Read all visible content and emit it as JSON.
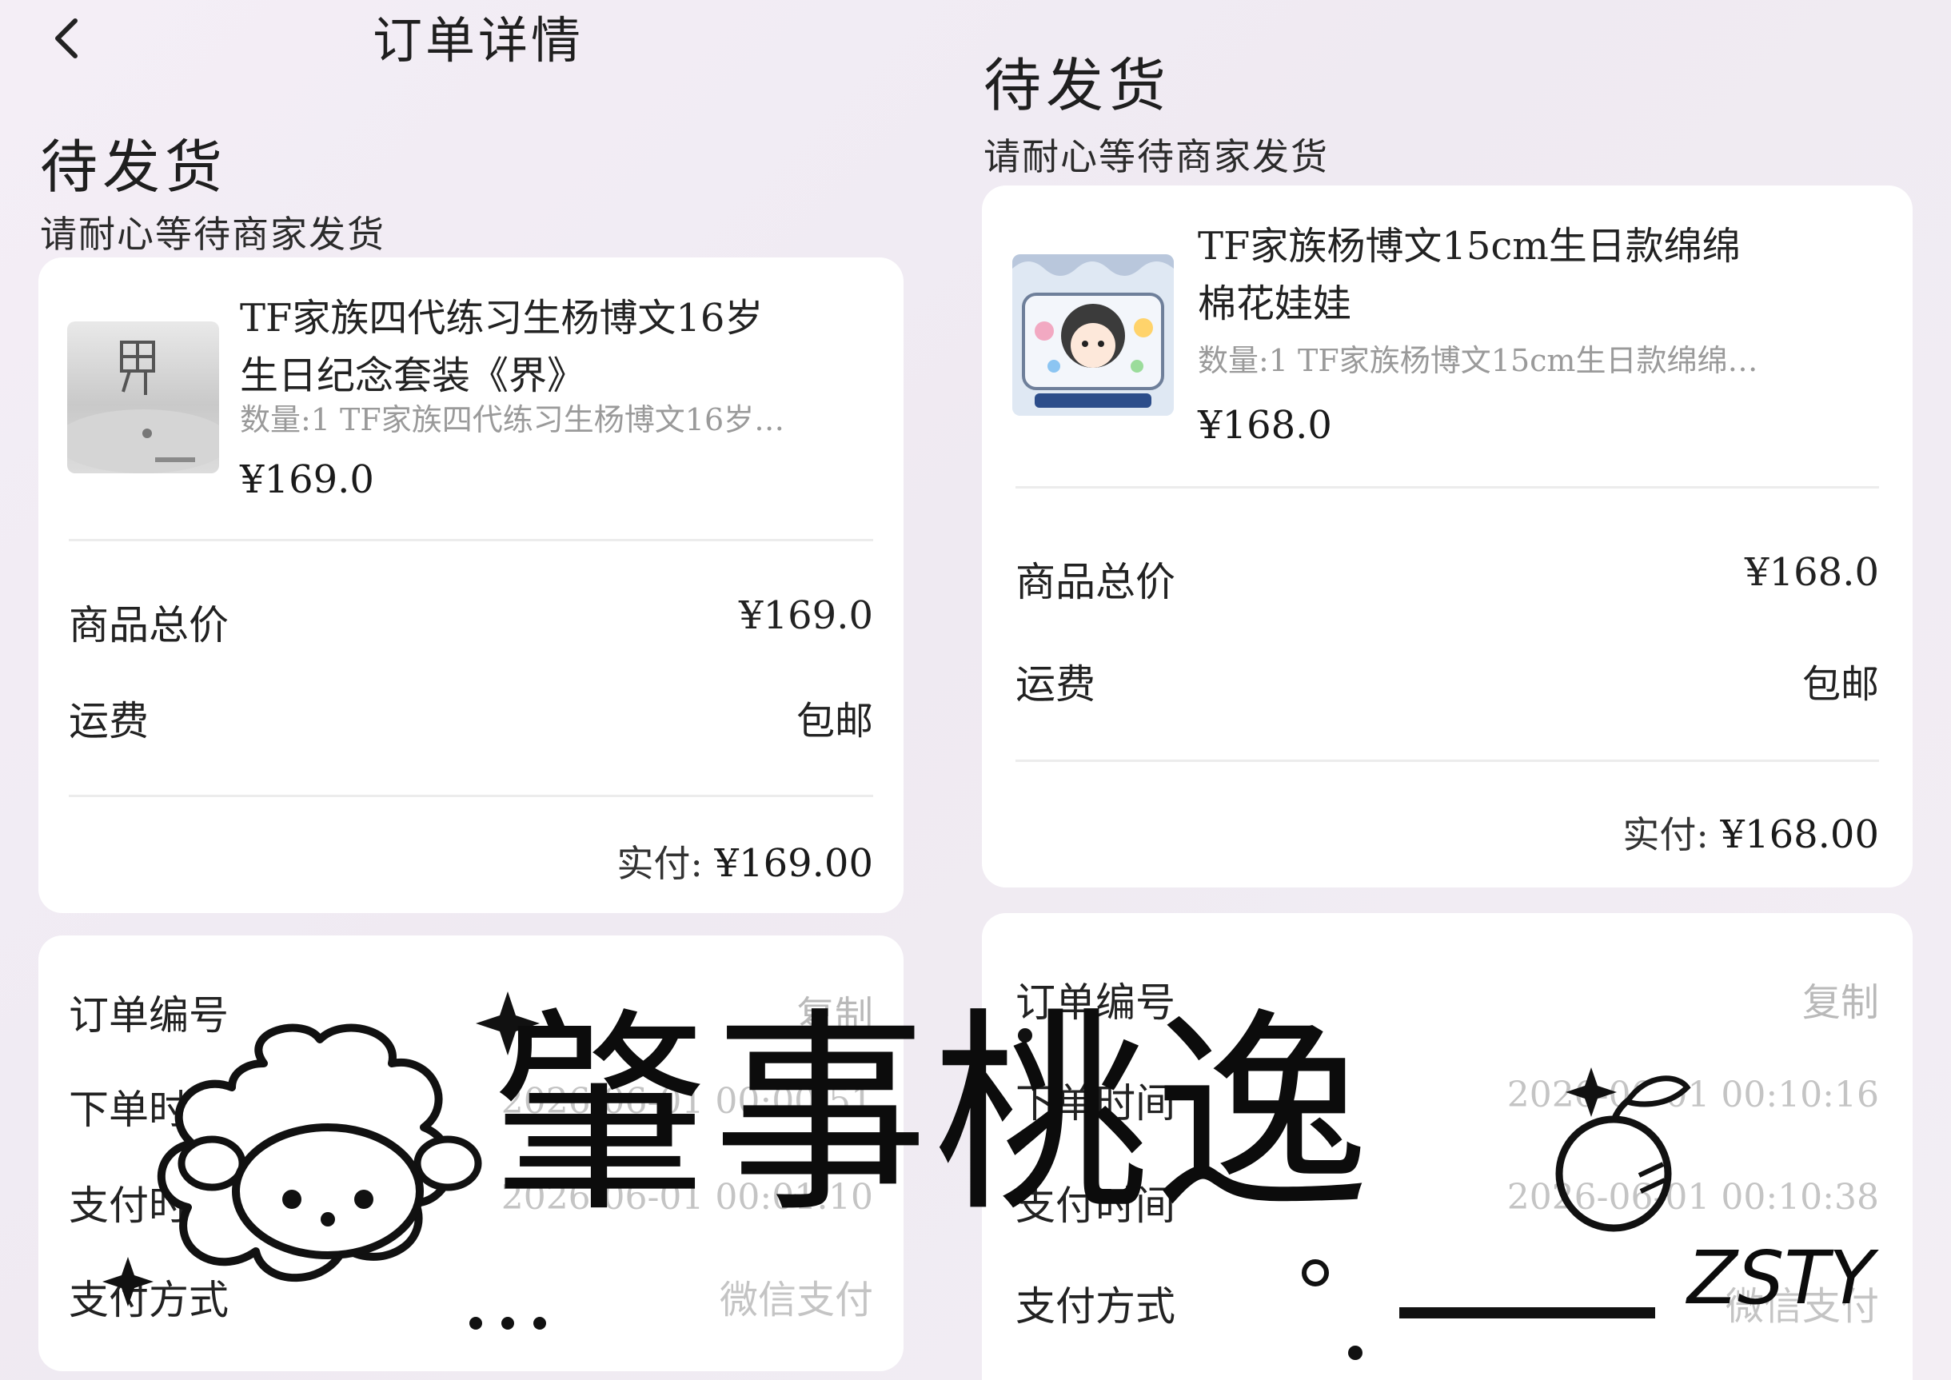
{
  "header": {
    "title": "订单详情"
  },
  "left": {
    "status_title": "待发货",
    "status_sub": "请耐心等待商家发货",
    "product": {
      "title_line1": "TF家族四代练习生杨博文16岁",
      "title_line2": "生日纪念套装《界》",
      "sub": "数量:1 TF家族四代练习生杨博文16岁…",
      "price": "¥169.0"
    },
    "summary": {
      "total_label": "商品总价",
      "total_value": "¥169.0",
      "shipping_label": "运费",
      "shipping_value": "包邮",
      "paid_label": "实付:",
      "paid_value": "¥169.00"
    },
    "info": {
      "order_no_label": "订单编号",
      "copy_label": "复制",
      "order_time_label": "下单时间",
      "order_time_value": "2026-06-01 00:00:51",
      "pay_time_label": "支付时间",
      "pay_time_value": "2026-06-01 00:01:10",
      "pay_method_label": "支付方式",
      "pay_method_value": "微信支付"
    }
  },
  "right": {
    "status_title": "待发货",
    "status_sub": "请耐心等待商家发货",
    "product": {
      "title_line1": "TF家族杨博文15cm生日款绵绵",
      "title_line2": "棉花娃娃",
      "sub": "数量:1 TF家族杨博文15cm生日款绵绵…",
      "price": "¥168.0"
    },
    "summary": {
      "total_label": "商品总价",
      "total_value": "¥168.0",
      "shipping_label": "运费",
      "shipping_value": "包邮",
      "paid_label": "实付:",
      "paid_value": "¥168.00"
    },
    "info": {
      "order_no_label": "订单编号",
      "copy_label": "复制",
      "order_time_label": "下单时间",
      "order_time_value": "2026-06-01 00:10:16",
      "pay_time_label": "支付时间",
      "pay_time_value": "2026-06-01 00:10:38",
      "pay_method_label": "支付方式",
      "pay_method_value": "微信支付"
    }
  },
  "watermark": {
    "text": "肇事桃逸",
    "latin": "ZSTY"
  }
}
